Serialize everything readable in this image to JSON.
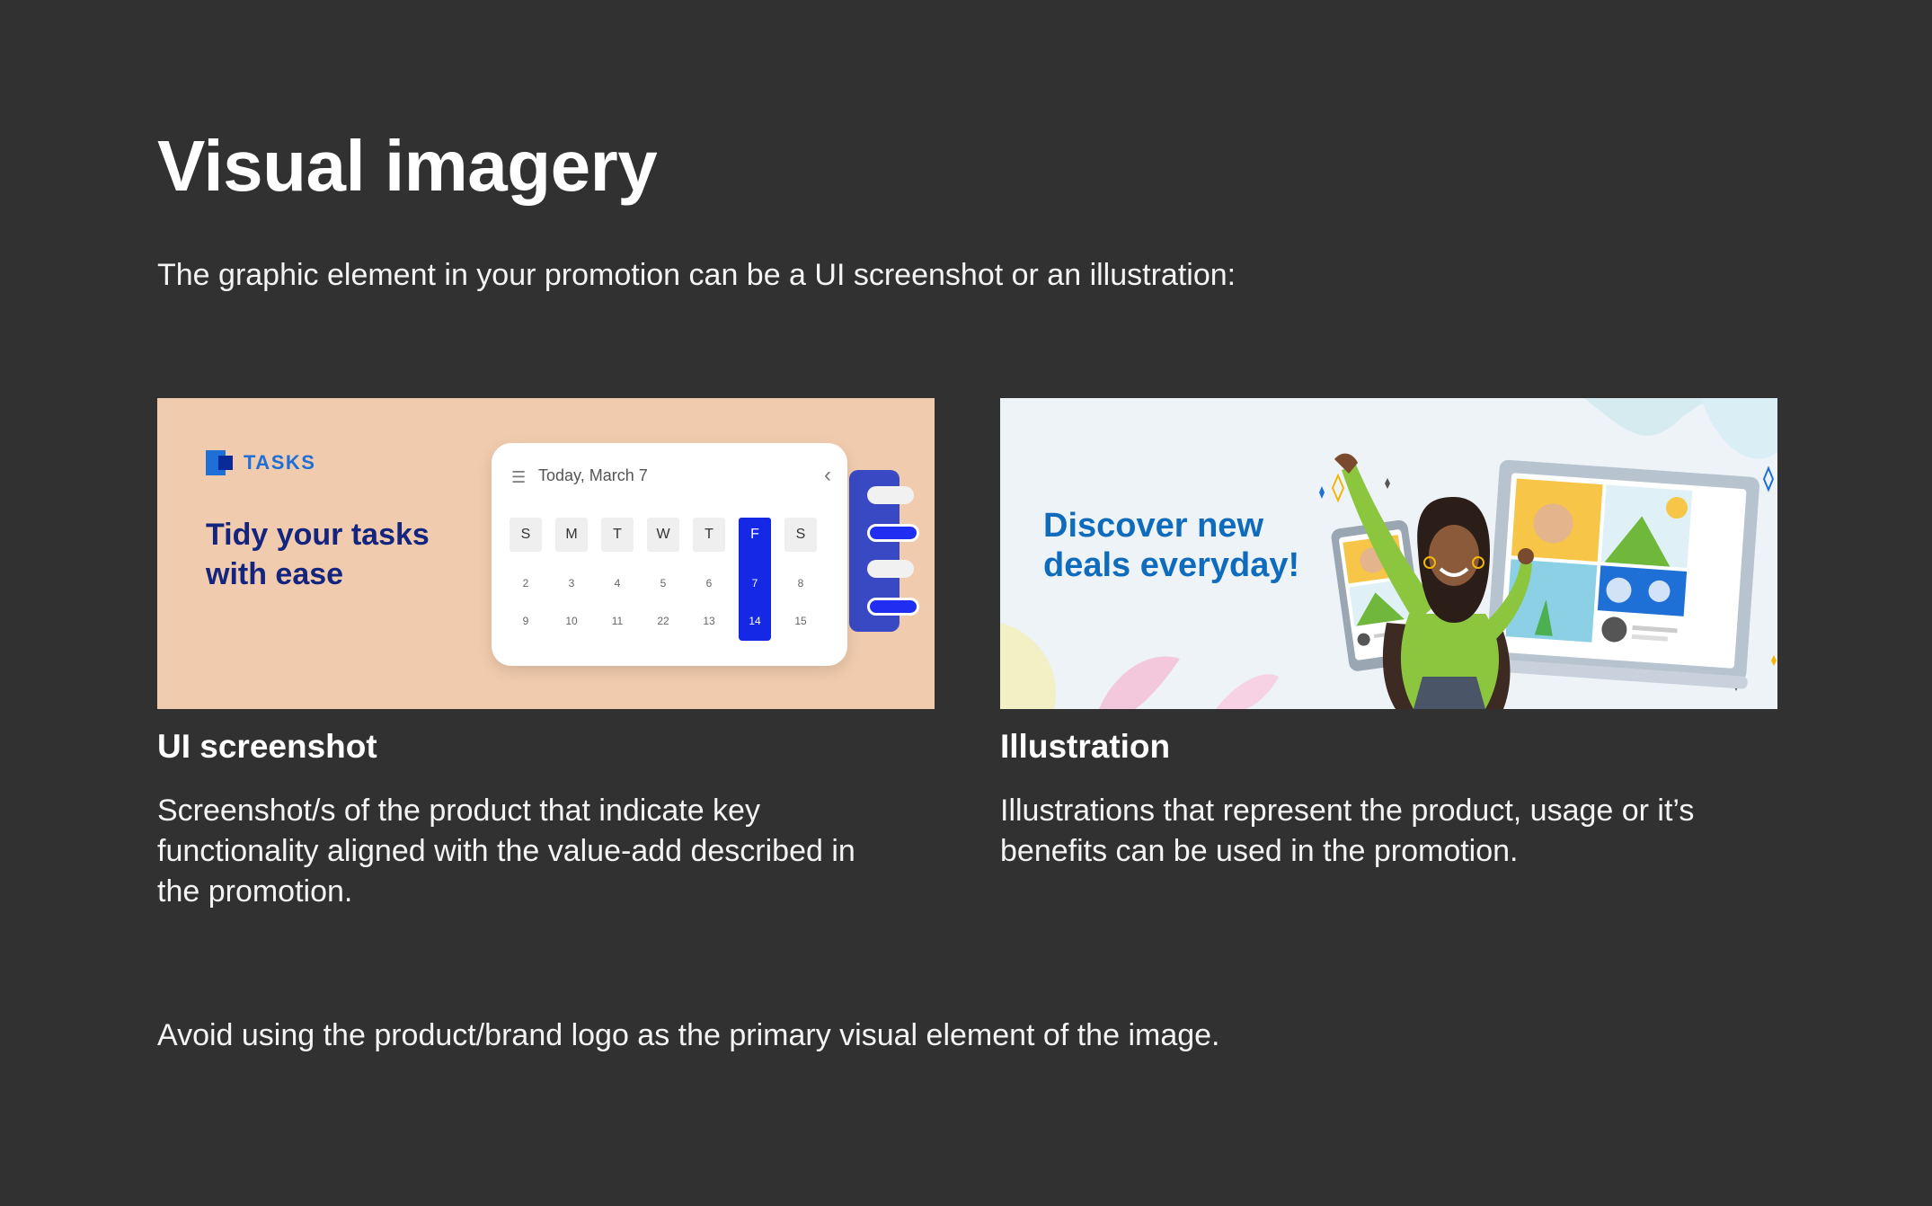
{
  "page": {
    "title": "Visual imagery",
    "intro": "The graphic element in your promotion can be a UI screenshot or an illustration:",
    "footer_note": "Avoid using the product/brand logo as the primary visual element of the image."
  },
  "cards": [
    {
      "title": "UI screenshot",
      "description": "Screenshot/s of the product that indicate key functionality aligned with the value-add described in the promotion.",
      "image": {
        "logo_text": "TASKS",
        "headline": "Tidy your tasks with ease",
        "calendar": {
          "date_label": "Today, March 7",
          "days": [
            "S",
            "M",
            "T",
            "W",
            "T",
            "F",
            "S"
          ],
          "row1": [
            "2",
            "3",
            "4",
            "5",
            "6",
            "7",
            "8"
          ],
          "row2": [
            "9",
            "10",
            "11",
            "22",
            "13",
            "14",
            "15"
          ],
          "selected_day": "F"
        }
      }
    },
    {
      "title": "Illustration",
      "description": "Illustrations that represent the product, usage or it’s benefits can be used in the promotion.",
      "image": {
        "headline": "Discover new deals everyday!"
      }
    }
  ],
  "colors": {
    "background": "#313131",
    "card1_background": "#f1cbad",
    "tasks_blue": "#1e6fd6",
    "tasks_navy": "#13257e",
    "calendar_selected": "#1428e6",
    "deals_blue": "#0f6cbd",
    "person_sweater": "#8cc63f"
  },
  "icons": {
    "calendar_menu": "hamburger-menu-icon",
    "calendar_back": "chevron-left-icon"
  }
}
